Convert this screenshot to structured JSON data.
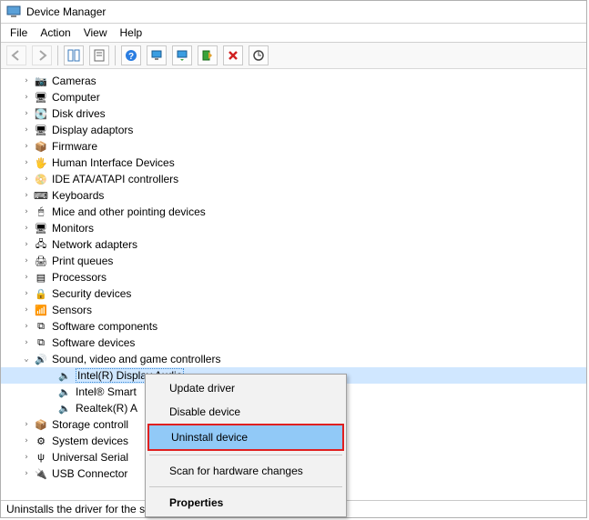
{
  "window": {
    "title": "Device Manager"
  },
  "menu": {
    "items": [
      "File",
      "Action",
      "View",
      "Help"
    ]
  },
  "toolbar": {
    "back": "←",
    "forward": "→",
    "items": [
      "back",
      "forward",
      "|",
      "show",
      "props",
      "|",
      "help",
      "enable",
      "update",
      "uninstall",
      "x",
      "scan"
    ]
  },
  "tree": {
    "items": [
      {
        "lvl": 1,
        "exp": ">",
        "icon": "camera-icon",
        "label": "Cameras"
      },
      {
        "lvl": 1,
        "exp": ">",
        "icon": "computer-icon",
        "label": "Computer"
      },
      {
        "lvl": 1,
        "exp": ">",
        "icon": "disk-icon",
        "label": "Disk drives"
      },
      {
        "lvl": 1,
        "exp": ">",
        "icon": "display-icon",
        "label": "Display adaptors"
      },
      {
        "lvl": 1,
        "exp": ">",
        "icon": "firmware-icon",
        "label": "Firmware"
      },
      {
        "lvl": 1,
        "exp": ">",
        "icon": "hid-icon",
        "label": "Human Interface Devices"
      },
      {
        "lvl": 1,
        "exp": ">",
        "icon": "ide-icon",
        "label": "IDE ATA/ATAPI controllers"
      },
      {
        "lvl": 1,
        "exp": ">",
        "icon": "keyboard-icon",
        "label": "Keyboards"
      },
      {
        "lvl": 1,
        "exp": ">",
        "icon": "mouse-icon",
        "label": "Mice and other pointing devices"
      },
      {
        "lvl": 1,
        "exp": ">",
        "icon": "monitor-icon",
        "label": "Monitors"
      },
      {
        "lvl": 1,
        "exp": ">",
        "icon": "network-icon",
        "label": "Network adapters"
      },
      {
        "lvl": 1,
        "exp": ">",
        "icon": "printer-icon",
        "label": "Print queues"
      },
      {
        "lvl": 1,
        "exp": ">",
        "icon": "cpu-icon",
        "label": "Processors"
      },
      {
        "lvl": 1,
        "exp": ">",
        "icon": "security-icon",
        "label": "Security devices"
      },
      {
        "lvl": 1,
        "exp": ">",
        "icon": "sensor-icon",
        "label": "Sensors"
      },
      {
        "lvl": 1,
        "exp": ">",
        "icon": "software-icon",
        "label": "Software components"
      },
      {
        "lvl": 1,
        "exp": ">",
        "icon": "software-icon",
        "label": "Software devices"
      },
      {
        "lvl": 1,
        "exp": "v",
        "icon": "sound-icon",
        "label": "Sound, video and game controllers"
      },
      {
        "lvl": 2,
        "exp": "",
        "icon": "speaker-icon",
        "label": "Intel(R) Display Audio",
        "selected": true
      },
      {
        "lvl": 2,
        "exp": "",
        "icon": "speaker-icon",
        "label": "Intel® Smart"
      },
      {
        "lvl": 2,
        "exp": "",
        "icon": "speaker-icon",
        "label": "Realtek(R) A"
      },
      {
        "lvl": 1,
        "exp": ">",
        "icon": "storage-icon",
        "label": "Storage controll"
      },
      {
        "lvl": 1,
        "exp": ">",
        "icon": "system-icon",
        "label": "System devices"
      },
      {
        "lvl": 1,
        "exp": ">",
        "icon": "usb-icon",
        "label": "Universal Serial "
      },
      {
        "lvl": 1,
        "exp": ">",
        "icon": "usb-connector-icon",
        "label": "USB Connector "
      }
    ]
  },
  "context_menu": {
    "items": [
      {
        "label": "Update driver"
      },
      {
        "label": "Disable device"
      },
      {
        "label": "Uninstall device",
        "highlight": true,
        "red": true
      },
      {
        "sep": true
      },
      {
        "label": "Scan for hardware changes"
      },
      {
        "sep": true
      },
      {
        "label": "Properties",
        "bold": true
      }
    ]
  },
  "status": {
    "text": "Uninstalls the driver for the selected device."
  },
  "icons": {
    "camera-icon": "📷",
    "computer-icon": "🖥",
    "disk-icon": "💽",
    "display-icon": "🖥",
    "firmware-icon": "📦",
    "hid-icon": "🖐",
    "ide-icon": "📀",
    "keyboard-icon": "⌨",
    "mouse-icon": "🖱",
    "monitor-icon": "🖥",
    "network-icon": "🖧",
    "printer-icon": "🖨",
    "cpu-icon": "▤",
    "security-icon": "🔒",
    "sensor-icon": "📶",
    "software-icon": "⧉",
    "sound-icon": "🔊",
    "speaker-icon": "🔈",
    "storage-icon": "📦",
    "system-icon": "⚙",
    "usb-icon": "ψ",
    "usb-connector-icon": "🔌",
    "device-manager-icon": "🖥"
  }
}
